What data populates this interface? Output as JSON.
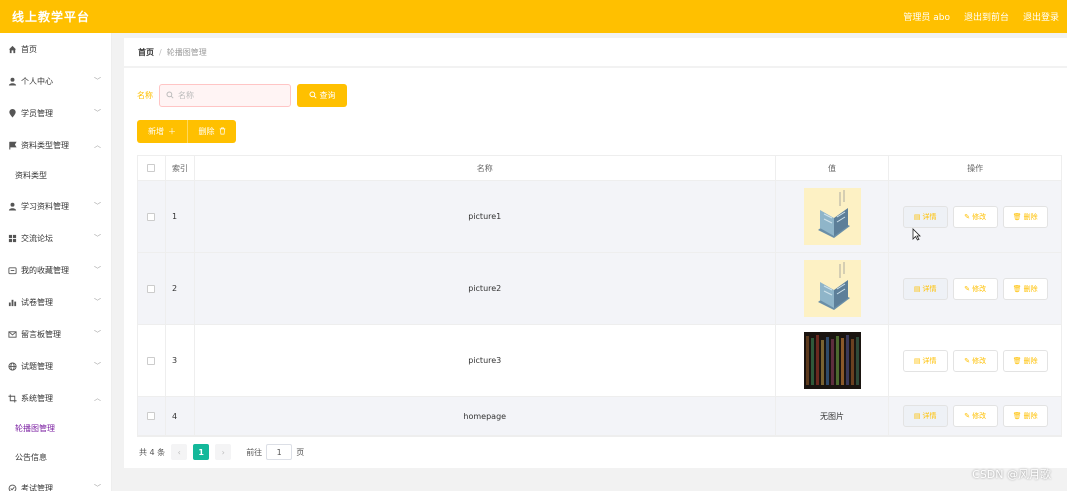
{
  "app": {
    "title": "线上教学平台",
    "user_label": "管理员 abo",
    "frontend_link": "退出到前台",
    "logout_link": "退出登录"
  },
  "sidebar": {
    "items": [
      {
        "label": "首页",
        "icon": "home-icon",
        "expandable": false
      },
      {
        "label": "个人中心",
        "icon": "user-icon",
        "expandable": true
      },
      {
        "label": "学员管理",
        "icon": "location-icon",
        "expandable": true
      },
      {
        "label": "资料类型管理",
        "icon": "flag-icon",
        "expandable": true,
        "expanded": true,
        "children": [
          "资料类型"
        ]
      },
      {
        "label": "学习资料管理",
        "icon": "user-icon",
        "expandable": true
      },
      {
        "label": "交流论坛",
        "icon": "grid-icon",
        "expandable": true
      },
      {
        "label": "我的收藏管理",
        "icon": "folder-icon",
        "expandable": true
      },
      {
        "label": "试卷管理",
        "icon": "chart-icon",
        "expandable": true
      },
      {
        "label": "留言板管理",
        "icon": "mail-icon",
        "expandable": true
      },
      {
        "label": "试题管理",
        "icon": "globe-icon",
        "expandable": true
      },
      {
        "label": "系统管理",
        "icon": "crop-icon",
        "expandable": true,
        "expanded": true,
        "children": [
          "轮播图管理",
          "公告信息"
        ],
        "active_child": "轮播图管理"
      },
      {
        "label": "考试管理",
        "icon": "exam-icon",
        "expandable": true
      }
    ]
  },
  "breadcrumb": {
    "home": "首页",
    "separator": "/",
    "current": "轮播图管理"
  },
  "search": {
    "label": "名称",
    "placeholder": "名称",
    "button_label": "查询"
  },
  "actions": {
    "add_label": "新增",
    "delete_label": "删除"
  },
  "table": {
    "headers": {
      "index": "索引",
      "name": "名称",
      "value": "值",
      "ops": "操作"
    },
    "rows": [
      {
        "index": "1",
        "name": "picture1",
        "image": "book",
        "value_text": ""
      },
      {
        "index": "2",
        "name": "picture2",
        "image": "book",
        "value_text": ""
      },
      {
        "index": "3",
        "name": "picture3",
        "image": "shelf",
        "value_text": ""
      },
      {
        "index": "4",
        "name": "homepage",
        "image": "none",
        "value_text": "无图片"
      }
    ],
    "op_labels": {
      "detail": "详情",
      "edit": "修改",
      "delete": "删除"
    }
  },
  "pagination": {
    "total_text": "共 4 条",
    "prev": "‹",
    "current_page": "1",
    "next": "›",
    "goto_label": "前往",
    "goto_value": "1",
    "page_unit": "页"
  },
  "watermark": "CSDN @风月歌",
  "colors": {
    "primary": "#ffc000",
    "active_menu": "#7b1fa2",
    "pager_active": "#13b89a"
  }
}
